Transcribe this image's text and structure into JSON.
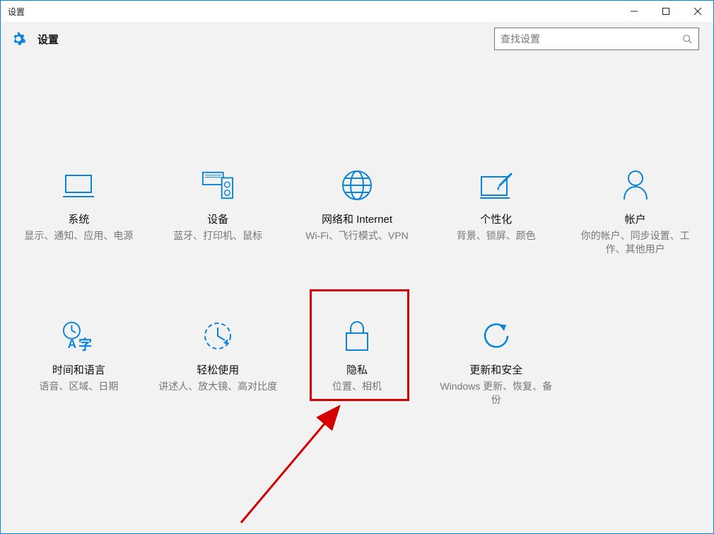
{
  "window": {
    "title": "设置"
  },
  "header": {
    "app_title": "设置",
    "search_placeholder": "查找设置"
  },
  "categories": [
    {
      "id": "system",
      "title": "系统",
      "desc": "显示、通知、应用、电源"
    },
    {
      "id": "devices",
      "title": "设备",
      "desc": "蓝牙、打印机、鼠标"
    },
    {
      "id": "network",
      "title": "网络和 Internet",
      "desc": "Wi-Fi、飞行模式、VPN"
    },
    {
      "id": "personal",
      "title": "个性化",
      "desc": "背景、锁屏、颜色"
    },
    {
      "id": "accounts",
      "title": "帐户",
      "desc": "你的帐户、同步设置、工作、其他用户"
    },
    {
      "id": "timelang",
      "title": "时间和语言",
      "desc": "语音、区域、日期"
    },
    {
      "id": "ease",
      "title": "轻松使用",
      "desc": "讲述人、放大镜、高对比度"
    },
    {
      "id": "privacy",
      "title": "隐私",
      "desc": "位置、相机"
    },
    {
      "id": "update",
      "title": "更新和安全",
      "desc": "Windows 更新、恢复、备份"
    }
  ],
  "colors": {
    "accent": "#0a84d8",
    "icon": "#0a84d8",
    "desc": "#777777",
    "highlight": "#d40000"
  },
  "annotation": {
    "highlighted_category": "privacy"
  }
}
